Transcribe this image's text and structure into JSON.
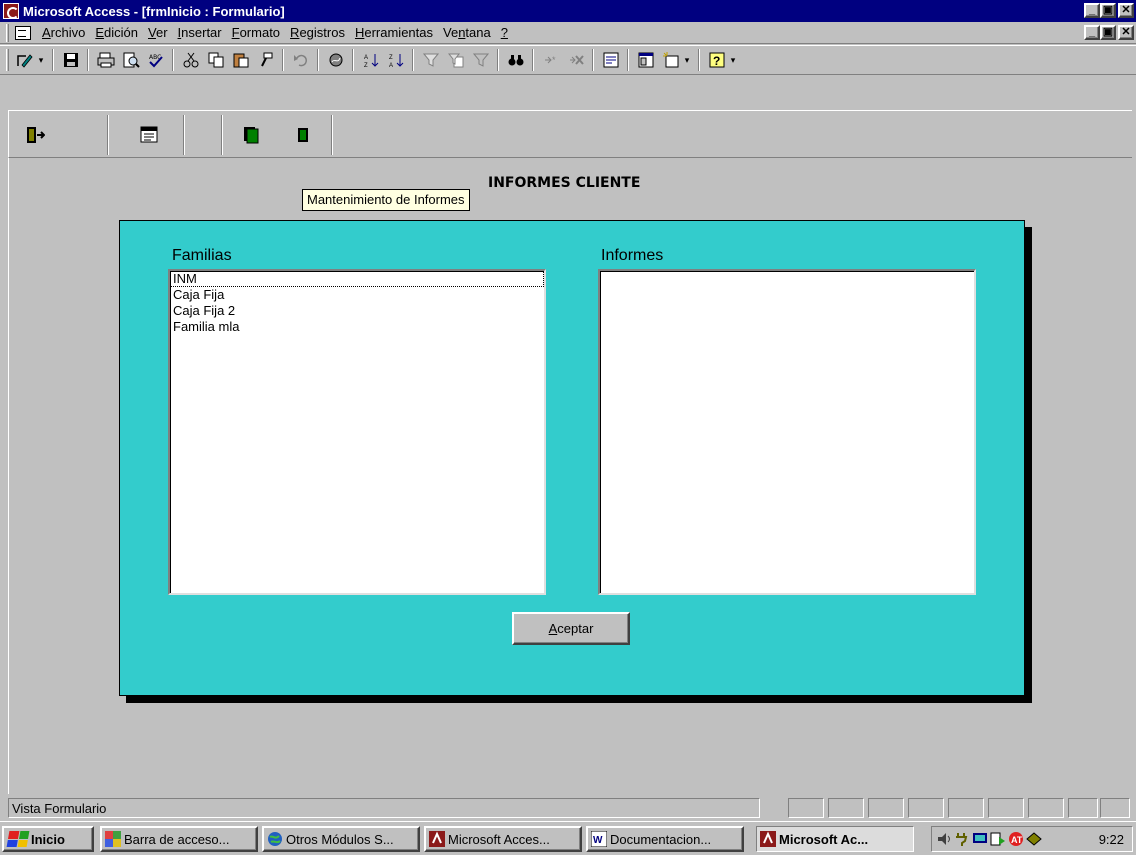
{
  "window": {
    "title": "Microsoft Access - [frmInicio : Formulario]",
    "minimize": "_",
    "restore": "▣",
    "close": "✕"
  },
  "menu": {
    "items": [
      {
        "pre": "",
        "u": "A",
        "post": "rchivo"
      },
      {
        "pre": "",
        "u": "E",
        "post": "dición"
      },
      {
        "pre": "",
        "u": "V",
        "post": "er"
      },
      {
        "pre": "",
        "u": "I",
        "post": "nsertar"
      },
      {
        "pre": "",
        "u": "F",
        "post": "ormato"
      },
      {
        "pre": "",
        "u": "R",
        "post": "egistros"
      },
      {
        "pre": "",
        "u": "H",
        "post": "erramientas"
      },
      {
        "pre": "Ve",
        "u": "n",
        "post": "tana"
      },
      {
        "pre": "",
        "u": "?",
        "post": ""
      }
    ]
  },
  "toolbar_icons": [
    "design-view-icon",
    "save-icon",
    "print-icon",
    "print-preview-icon",
    "spelling-icon",
    "cut-icon",
    "copy-icon",
    "paste-icon",
    "format-painter-icon",
    "undo-icon",
    "hyperlink-icon",
    "sort-ascending-icon",
    "sort-descending-icon",
    "filter-by-selection-icon",
    "filter-by-form-icon",
    "apply-filter-icon",
    "find-icon",
    "new-record-icon",
    "delete-record-icon",
    "properties-icon",
    "database-window-icon",
    "new-object-icon",
    "help-icon"
  ],
  "form": {
    "title": "INFORMES CLIENTE",
    "tooltip": "Mantenimiento de Informes",
    "families_label": "Familias",
    "reports_label": "Informes",
    "families": [
      "INM",
      "Caja Fija",
      "Caja Fija 2",
      "Familia mla"
    ],
    "reports": [],
    "accept_pre": "",
    "accept_u": "A",
    "accept_post": "ceptar"
  },
  "status": {
    "text": "Vista Formulario"
  },
  "taskbar": {
    "start": "Inicio",
    "tasks": [
      "Barra de acceso...",
      "Otros Módulos S...",
      "Microsoft Acces...",
      "Documentacion...",
      "Microsoft Ac..."
    ],
    "clock": "9:22"
  },
  "colors": {
    "titlebar": "#000080",
    "form_panel": "#33cccc",
    "tooltip_bg": "#ffffe1",
    "window_face": "#c0c0c0"
  }
}
